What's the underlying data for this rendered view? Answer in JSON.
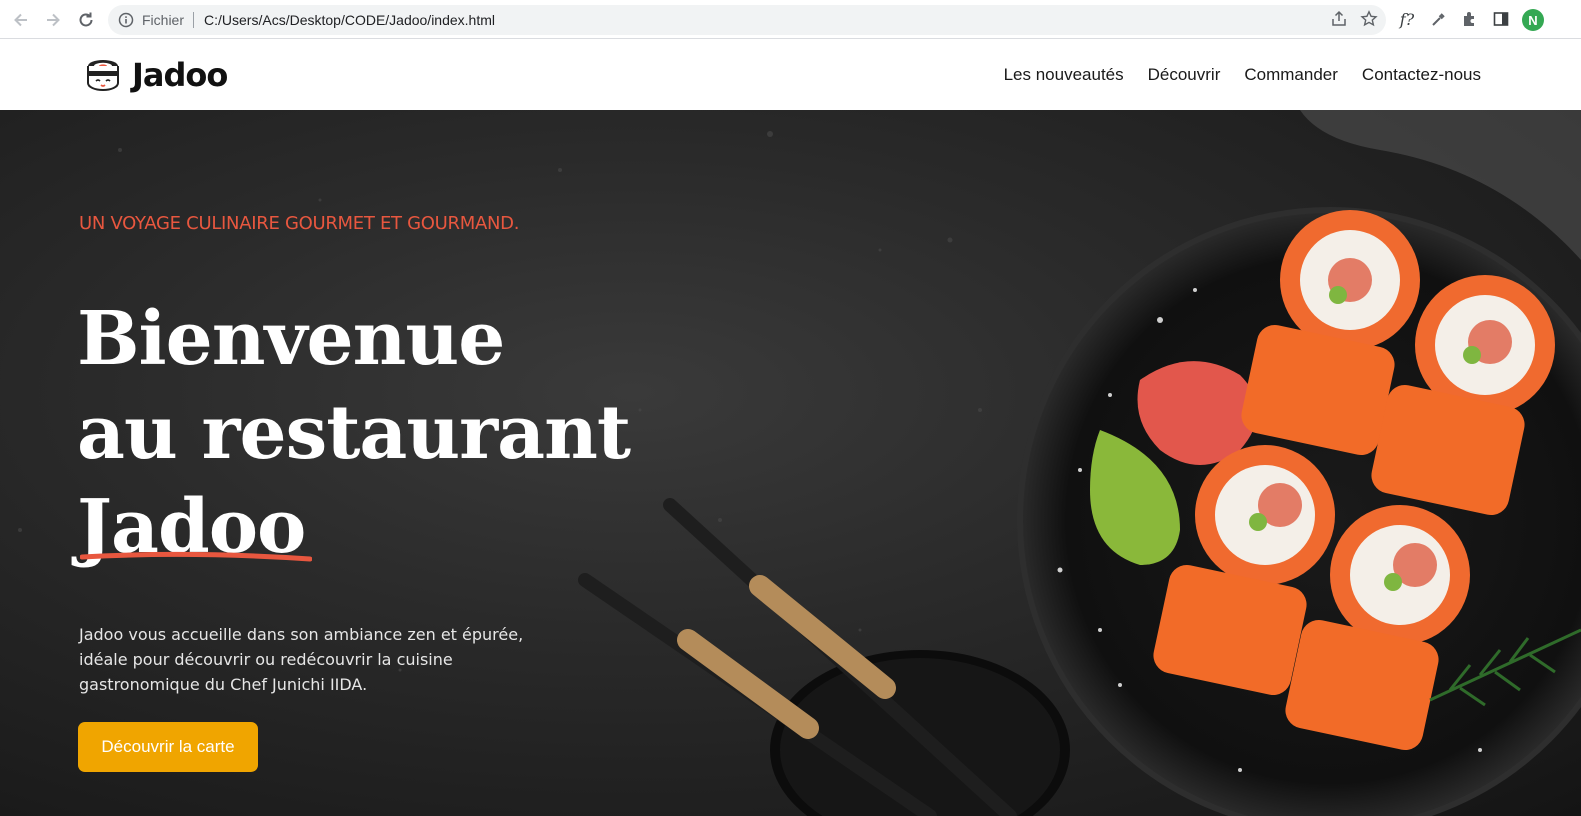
{
  "browser": {
    "scheme_label": "Fichier",
    "url": "C:/Users/Acs/Desktop/CODE/Jadoo/index.html",
    "profile_initial": "N",
    "icons": [
      "back-arrow-icon",
      "forward-arrow-icon",
      "reload-icon",
      "info-icon",
      "share-icon",
      "star-icon",
      "font-icon",
      "eyedropper-icon",
      "extensions-icon",
      "sidebar-icon"
    ]
  },
  "site": {
    "logo_name": "Jadoo",
    "nav": [
      "Les nouveautés",
      "Découvrir",
      "Commander",
      "Contactez-nous"
    ]
  },
  "hero": {
    "tagline": "UN VOYAGE CULINAIRE GOURMET ET GOURMAND.",
    "title_line1": "Bienvenue",
    "title_line2": "au restaurant",
    "title_line3": "Jadoo",
    "description": "Jadoo vous accueille dans son ambiance zen et épurée, idéale pour découvrir ou redécouvrir la cuisine gastronomique du Chef Junichi IIDA.",
    "cta_label": "Découvrir la carte"
  },
  "colors": {
    "accent_orange": "#f0a500",
    "tagline_red": "#e8573f",
    "hero_bg": "#1c1c1c"
  }
}
